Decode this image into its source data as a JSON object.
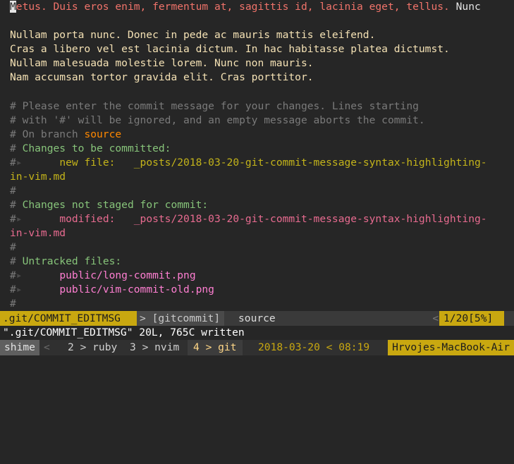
{
  "editor": {
    "line1": {
      "cursor_char": "M",
      "rest": "etus. Duis eros enim, fermentum at, sagittis id, lacinia eget, tellus.",
      "overflow": "Nunc"
    },
    "body_lines": [
      "Nullam porta nunc. Donec in pede ac mauris mattis eleifend.",
      "Cras a libero vel est lacinia dictum. In hac habitasse platea dictumst.",
      "Nullam malesuada molestie lorem. Nunc non mauris.",
      "Nam accumsan tortor gravida elit. Cras porttitor."
    ],
    "comment1": "# Please enter the commit message for your changes. Lines starting",
    "comment2": "# with '#' will be ignored, and an empty message aborts the commit.",
    "on_branch_prefix": "# On branch ",
    "branch_name": "source",
    "hash": "#",
    "changes_committed_header": "Changes to be committed:",
    "new_file_label": "new file:",
    "new_file_path": "_posts/2018-03-20-git-commit-message-syntax-highlighting-",
    "wrapped_path": "in-vim.md",
    "changes_not_staged_header": "Changes not staged for commit:",
    "modified_label": "modified:",
    "modified_path": "_posts/2018-03-20-git-commit-message-syntax-highlighting-",
    "untracked_header": "Untracked files:",
    "untracked_files": [
      "public/long-commit.png",
      "public/vim-commit-old.png"
    ],
    "tab_marker": "▸"
  },
  "statusline": {
    "file": ".git/COMMIT_EDITMSG",
    "filetype": "> [gitcommit]",
    "branch": "source",
    "separator": "<<",
    "position": "1/20[5%]"
  },
  "cmdline": "\".git/COMMIT_EDITMSG\" 20L, 765C written",
  "tmux": {
    "session": "shime",
    "windows": [
      "2 > ruby",
      "3 > nvim"
    ],
    "active_window": "4 > git",
    "datetime": "2018-03-20 < 08:19",
    "host": "Hrvojes-MacBook-Air"
  }
}
